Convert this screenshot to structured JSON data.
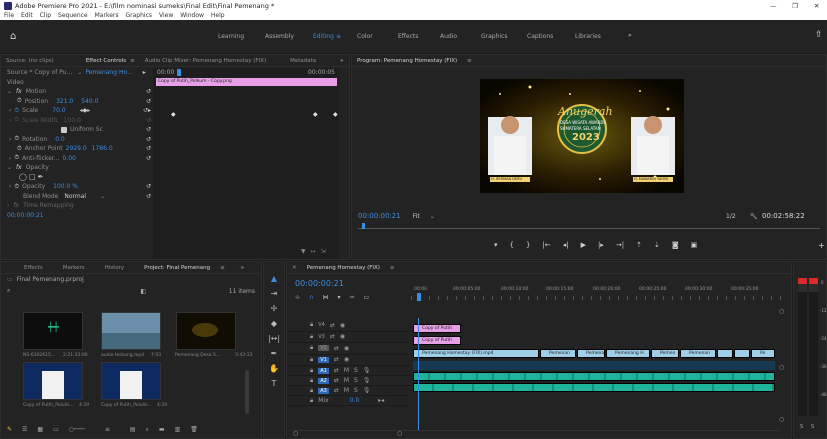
{
  "window": {
    "title": "Adobe Premiere Pro 2021 - E:\\film nominasi sumeks\\Final Edit\\Final Pemenang *",
    "app_icon": "premiere-icon",
    "minimize": "—",
    "maximize": "❐",
    "close": "✕"
  },
  "menu": [
    "File",
    "Edit",
    "Clip",
    "Sequence",
    "Markers",
    "Graphics",
    "View",
    "Window",
    "Help"
  ],
  "workspaces": {
    "tabs": [
      "Learning",
      "Assembly",
      "Editing",
      "Color",
      "Effects",
      "Audio",
      "Graphics",
      "Captions",
      "Libraries"
    ],
    "active": "Editing",
    "more": "»"
  },
  "source_tabs": [
    "Source: (no clips)",
    "Effect Controls",
    "Audio Clip Mixer: Pemenang Homestay (FIX)",
    "Metadata"
  ],
  "source_tabs_more": "»",
  "effect_controls": {
    "source_label": "Source * Copy of Pu...",
    "sequence_label": "Pemenang Ho...",
    "time_start": "00:00",
    "time_end": "00:00:05",
    "clip_name": "Copy of Putih_Polkum - Copy.png",
    "section_video": "Video",
    "fx_motion": "Motion",
    "position": {
      "label": "Position",
      "x": "321.0",
      "y": "540.0"
    },
    "scale": {
      "label": "Scale",
      "value": "70.0"
    },
    "scale_width": {
      "label": "Scale Width",
      "value": "100.0"
    },
    "uniform_scale": "Uniform Sc",
    "rotation": {
      "label": "Rotation",
      "value": "0.0"
    },
    "anchor": {
      "label": "Anchor Point",
      "x": "2929.0",
      "y": "1786.0"
    },
    "antiflicker": {
      "label": "Anti-flicker...",
      "value": "0.00"
    },
    "fx_opacity": "Opacity",
    "opacity": {
      "label": "Opacity",
      "value": "100.0 %"
    },
    "blend_mode": {
      "label": "Blend Mode",
      "value": "Normal"
    },
    "time_remap": "Time Remapping",
    "timecode": "00:00:00:21"
  },
  "program": {
    "title": "Program: Pemenang Homestay (FIX)",
    "timecode": "00:00:00:21",
    "fit": "Fit",
    "quality": "1/2",
    "duration": "00:02:58:22",
    "frame": {
      "title": "Anugerah",
      "subtitle1": "DESA WISATA AWARDS",
      "subtitle2": "SUMATERA SELATAN",
      "year": "2023",
      "left_caption": "H. HERMAN DERU",
      "right_caption": "H. MAWARDI YAHYA"
    }
  },
  "project": {
    "tabs": [
      "Effects",
      "Markers",
      "History",
      "Project: Final Pemenang"
    ],
    "active_tab": "Project: Final Pemenang",
    "more": "»",
    "file": "Final Pemenang.prproj",
    "items_count": "11 items",
    "items": [
      {
        "name": "NS-6302615...",
        "dur": "2:21:33:00"
      },
      {
        "name": "audio terbang.mp4",
        "dur": "7:03"
      },
      {
        "name": "Pemenang Desa S...",
        "dur": "3:43:13"
      },
      {
        "name": "Copy of Putih_Polulis...",
        "dur": "4:29"
      },
      {
        "name": "Copy of Putih_Polulis...",
        "dur": "4:29"
      }
    ]
  },
  "timeline": {
    "tab": "Pemenang Homestay (FIX)",
    "timecode": "00:00:00:21",
    "ruler": [
      "00:00",
      "00:00:05:00",
      "00:00:10:00",
      "00:00:15:00",
      "00:00:20:00",
      "00:00:25:00",
      "00:00:30:00",
      "00:00:35:00"
    ],
    "tracks": [
      {
        "name": "V4",
        "type": "video"
      },
      {
        "name": "V3",
        "type": "video"
      },
      {
        "name": "V2",
        "type": "video"
      },
      {
        "name": "V1",
        "type": "video"
      },
      {
        "name": "A1",
        "type": "audio"
      },
      {
        "name": "A2",
        "type": "audio"
      },
      {
        "name": "A3",
        "type": "audio"
      }
    ],
    "track_letters": {
      "m": "M",
      "s": "S"
    },
    "mix": {
      "label": "Mix",
      "value": "0.0"
    },
    "clip_copy_putih": "Copy of Putih",
    "clip_main": "Pemenang Homestay (FIX).mp4",
    "clip_pemenang": "Pemenan",
    "clip_pemena": "Pemena",
    "clip_pemenang_h": "Pemenang H",
    "clip_pemen": "Pemen",
    "clip_pe": "Pe"
  },
  "meter": {
    "scale": [
      "0",
      "-12",
      "-24",
      "-36",
      "-48"
    ],
    "solo": "S",
    "sub": "dB"
  },
  "colors": {
    "accent": "#2d8ceb",
    "video_clip": "#9fcfe8",
    "pink_clip": "#e7a0e8",
    "audio_clip": "#1eb39a",
    "playhead": "#3b8de0"
  }
}
